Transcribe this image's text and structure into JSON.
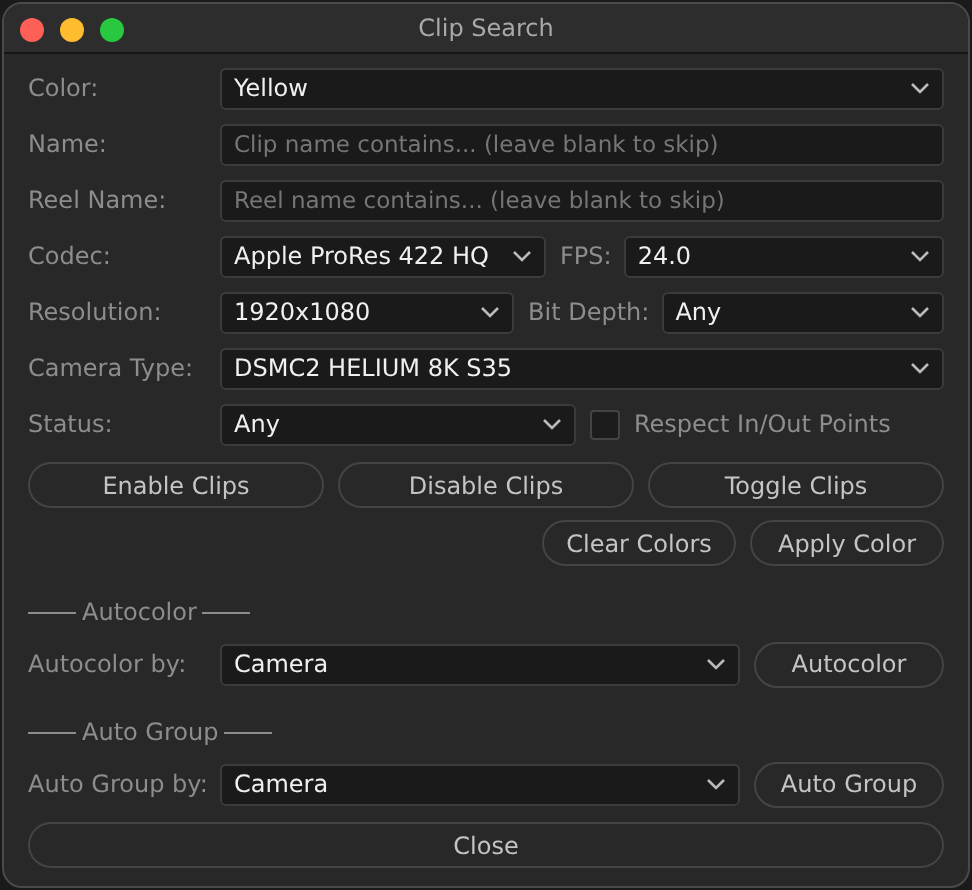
{
  "window": {
    "title": "Clip Search"
  },
  "color": {
    "label": "Color:",
    "value": "Yellow"
  },
  "name": {
    "label": "Name:",
    "placeholder": "Clip name contains... (leave blank to skip)"
  },
  "reel_name": {
    "label": "Reel Name:",
    "placeholder": "Reel name contains... (leave blank to skip)"
  },
  "codec": {
    "label": "Codec:",
    "value": "Apple ProRes 422 HQ"
  },
  "fps": {
    "label": "FPS:",
    "value": "24.0"
  },
  "resolution": {
    "label": "Resolution:",
    "value": "1920x1080"
  },
  "bit_depth": {
    "label": "Bit Depth:",
    "value": "Any"
  },
  "camera_type": {
    "label": "Camera Type:",
    "value": "DSMC2 HELIUM 8K S35"
  },
  "status": {
    "label": "Status:",
    "value": "Any"
  },
  "respect_in_out": {
    "label": "Respect In/Out Points",
    "checked": false
  },
  "clip_buttons": [
    "Enable Clips",
    "Disable Clips",
    "Toggle Clips"
  ],
  "color_buttons": [
    "Clear Colors",
    "Apply Color"
  ],
  "autocolor": {
    "heading": "Autocolor",
    "label": "Autocolor by:",
    "value": "Camera",
    "button": "Autocolor"
  },
  "auto_group": {
    "heading": "Auto Group",
    "label": "Auto Group by:",
    "value": "Camera",
    "button": "Auto Group"
  },
  "close_button": "Close"
}
